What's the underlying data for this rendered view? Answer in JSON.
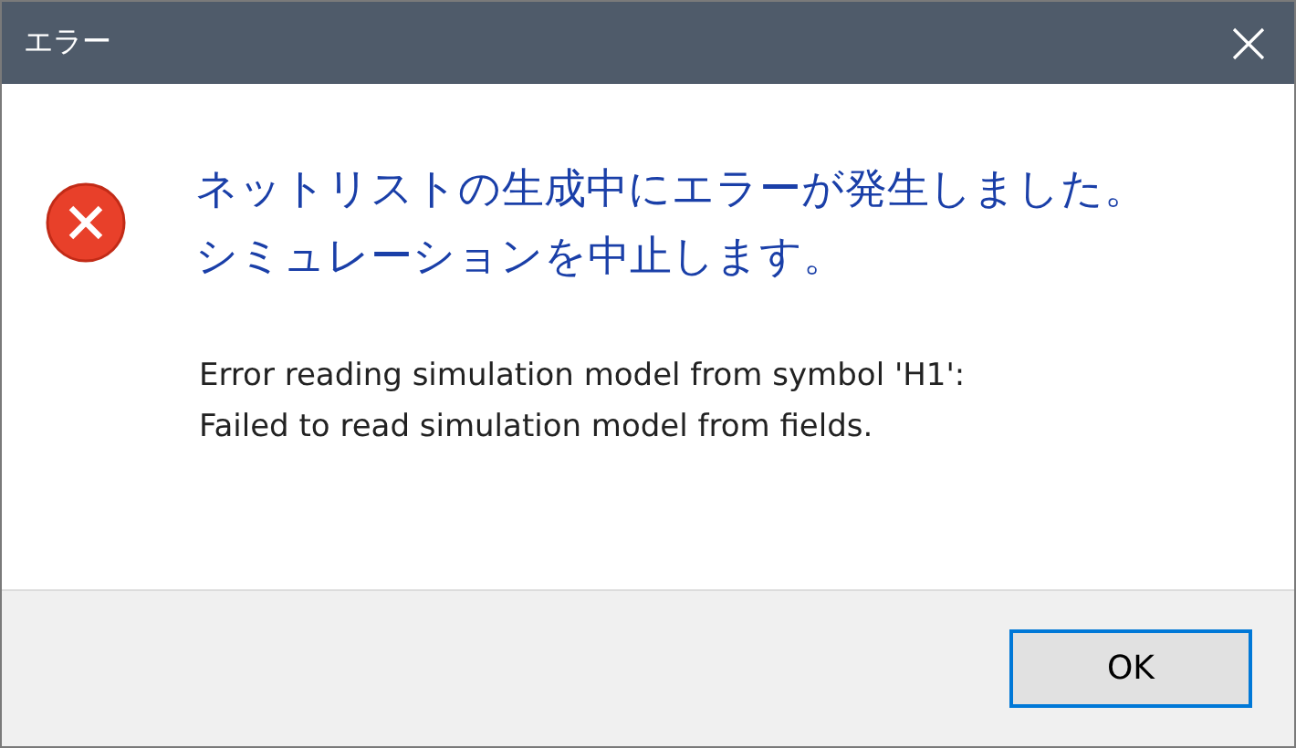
{
  "window": {
    "title": "エラー"
  },
  "message": {
    "main": [
      "ネットリストの生成中にエラーが発生しました。",
      "シミュレーションを中止します。"
    ],
    "detail": [
      "Error reading simulation model from symbol 'H1':",
      "Failed to read simulation model from fields."
    ]
  },
  "buttons": [
    {
      "label": "OK",
      "selected": true
    }
  ]
}
